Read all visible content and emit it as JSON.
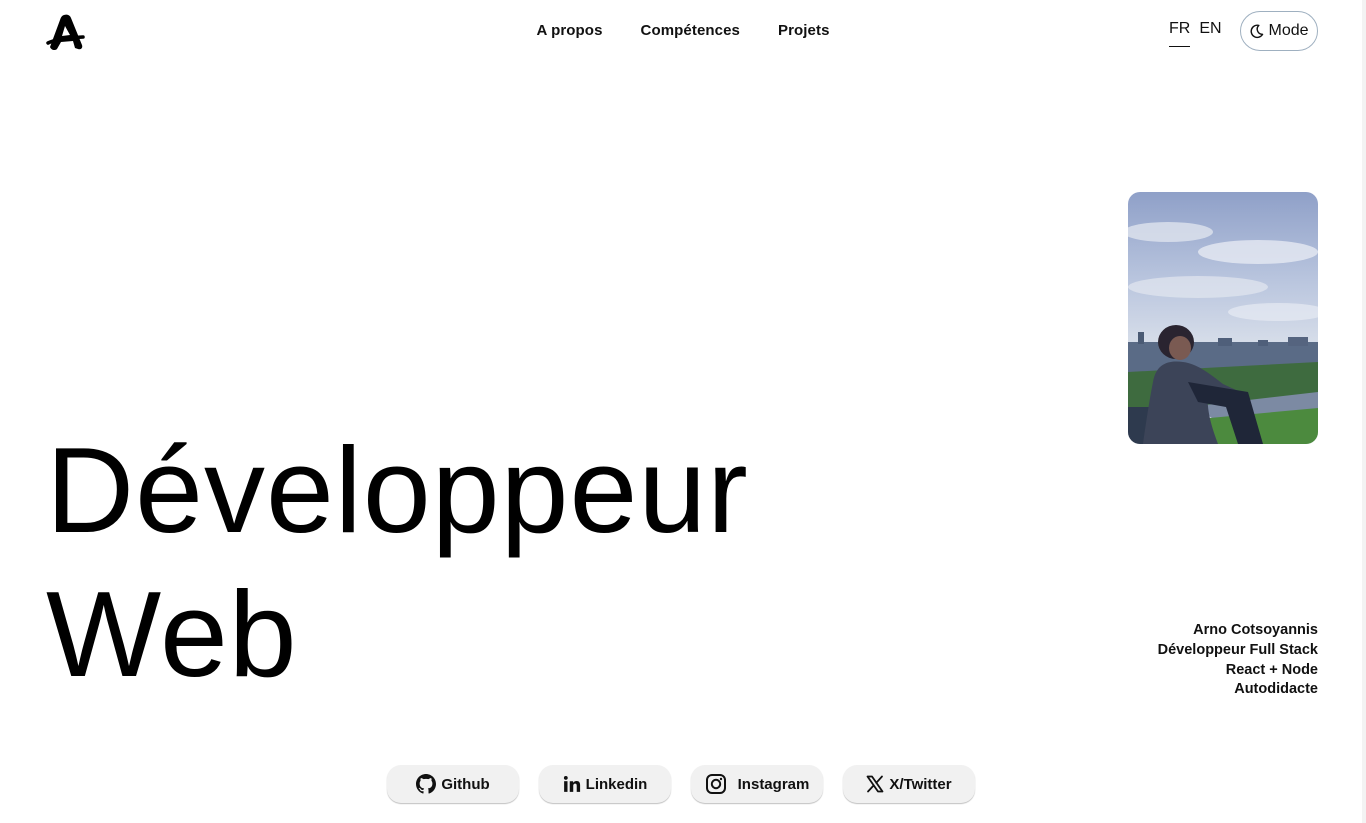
{
  "header": {
    "logo_icon": "stylized-letter-a-logo",
    "nav": [
      {
        "label": "A propos"
      },
      {
        "label": "Compétences"
      },
      {
        "label": "Projets"
      }
    ],
    "languages": [
      {
        "label": "FR",
        "active": true
      },
      {
        "label": "EN",
        "active": false
      }
    ],
    "mode_button": {
      "label": "Mode",
      "icon": "moon-icon"
    }
  },
  "hero": {
    "headline_line1": "Développeur",
    "headline_line2": "Web",
    "photo": {
      "icon": "profile-photo"
    },
    "bio": [
      "Arno Cotsoyannis",
      "Développeur Full Stack",
      "React + Node",
      "Autodidacte"
    ]
  },
  "socials": [
    {
      "label": "Github",
      "icon": "github-icon"
    },
    {
      "label": "Linkedin",
      "icon": "linkedin-icon"
    },
    {
      "label": "Instagram",
      "icon": "instagram-icon"
    },
    {
      "label": "X/Twitter",
      "icon": "x-twitter-icon"
    }
  ],
  "colors": {
    "background": "#ffffff",
    "text": "#000000",
    "button_bg": "#f1f1f1",
    "mode_border": "#9fb0c0"
  }
}
